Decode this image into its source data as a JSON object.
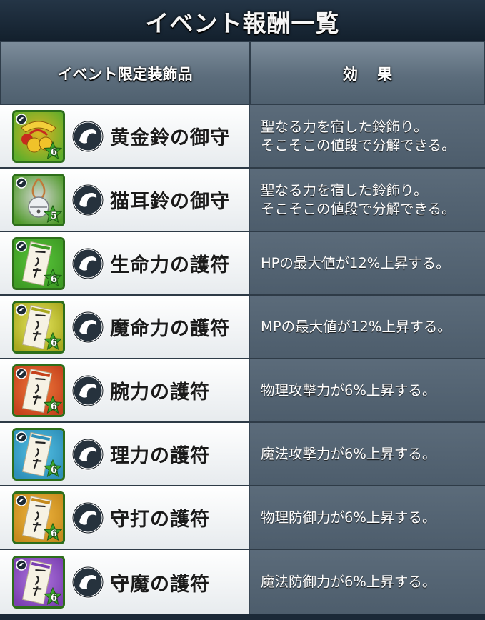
{
  "title": "イベント報酬一覧",
  "header": {
    "col_item": "イベント限定装飾品",
    "col_effect": "効 果"
  },
  "items": [
    {
      "name": "黄金鈴の御守",
      "effect": "聖なる力を宿した鈴飾り。\nそこそこの値段で分解できる。",
      "stars": "6",
      "icon": "golden-bell-charm-icon",
      "bg": "#5fae2b",
      "accent": "#e0b323"
    },
    {
      "name": "猫耳鈴の御守",
      "effect": "聖なる力を宿した鈴飾り。\nそこそこの値段で分解できる。",
      "stars": "5",
      "icon": "cat-ear-bell-charm-icon",
      "bg": "#4f9a2a",
      "accent": "#d8d8d8"
    },
    {
      "name": "生命力の護符",
      "effect": "HPの最大値が12%上昇する。",
      "stars": "6",
      "icon": "talisman-icon",
      "bg": "#3e9b24",
      "accent": "#59c63b"
    },
    {
      "name": "魔命力の護符",
      "effect": "MPの最大値が12%上昇する。",
      "stars": "6",
      "icon": "talisman-icon",
      "bg": "#a8a81e",
      "accent": "#e8e860"
    },
    {
      "name": "腕力の護符",
      "effect": "物理攻撃力が6%上昇する。",
      "stars": "6",
      "icon": "talisman-icon",
      "bg": "#c5421c",
      "accent": "#f07a3c"
    },
    {
      "name": "理力の護符",
      "effect": "魔法攻撃力が6%上昇する。",
      "stars": "6",
      "icon": "talisman-icon",
      "bg": "#2e8fb8",
      "accent": "#55c2e6"
    },
    {
      "name": "守打の護符",
      "effect": "物理防御力が6%上昇する。",
      "stars": "6",
      "icon": "talisman-icon",
      "bg": "#c58a1c",
      "accent": "#f2b640"
    },
    {
      "name": "守魔の護符",
      "effect": "魔法防御力が6%上昇する。",
      "stars": "6",
      "icon": "talisman-icon",
      "bg": "#7a3fb0",
      "accent": "#b077e0"
    }
  ],
  "accessory_icon": "accessory-type-icon"
}
